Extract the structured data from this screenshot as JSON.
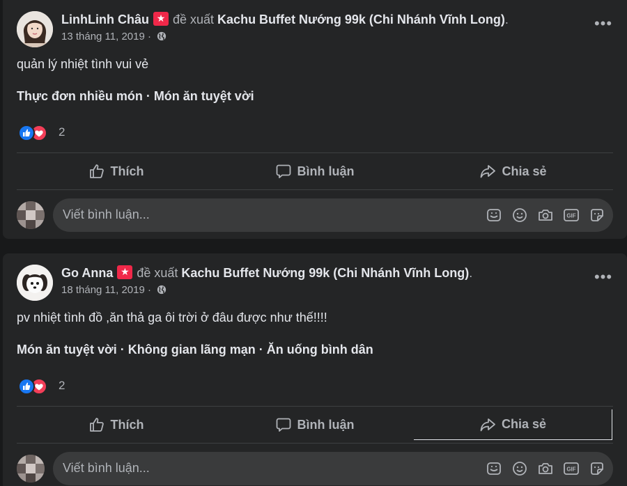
{
  "posts": [
    {
      "author": "LinhLinh Châu",
      "verb": "đề xuất",
      "place": "Kachu Buffet Nướng 99k (Chi Nhánh Vĩnh Long)",
      "period": ".",
      "date": "13 tháng 11, 2019",
      "separator": "·",
      "text": "quản lý nhiệt tình vui vẻ",
      "tags": "Thực đơn nhiều món · Món ăn tuyệt vời",
      "reaction_count": "2"
    },
    {
      "author": "Go Anna",
      "verb": "đề xuất",
      "place": "Kachu Buffet Nướng 99k (Chi Nhánh Vĩnh Long)",
      "period": ".",
      "date": "18 tháng 11, 2019",
      "separator": "·",
      "text": "pv nhiệt tình đồ ,ăn thả ga ôi trời ở đâu được như thế!!!!",
      "tags": "Món ăn tuyệt vời · Không gian lãng mạn · Ăn uống bình dân",
      "reaction_count": "2"
    }
  ],
  "actions": {
    "like": "Thích",
    "comment": "Bình luận",
    "share": "Chia sẻ"
  },
  "comment": {
    "placeholder": "Viết bình luận...",
    "tools": [
      "sticker-avatar-icon",
      "emoji-icon",
      "camera-icon",
      "gif-icon",
      "sticker-icon"
    ]
  },
  "icons": {
    "recommend_badge": "★",
    "more": "•••",
    "gif_label": "GIF"
  },
  "colors": {
    "background": "#18191a",
    "card": "#242526",
    "input": "#3a3b3c",
    "text_primary": "#e4e6eb",
    "text_secondary": "#b0b3b8",
    "like_blue": "#1877f2",
    "love_red": "#f33e58",
    "badge_red": "#f02849"
  }
}
